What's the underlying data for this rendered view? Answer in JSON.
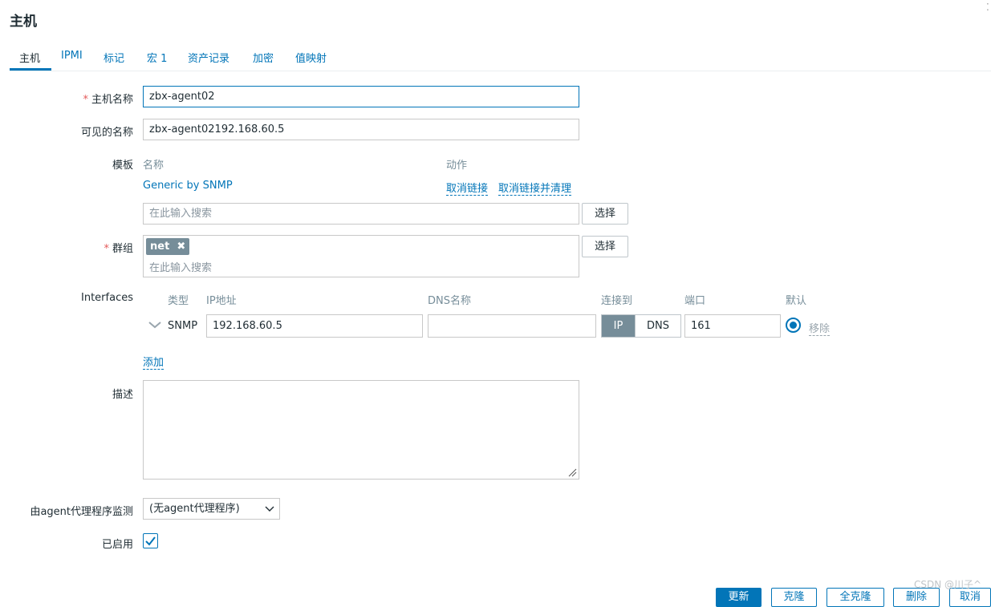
{
  "page_title": "主机",
  "tabs": [
    {
      "label": "主机"
    },
    {
      "label": "IPMI"
    },
    {
      "label": "标记"
    },
    {
      "label": "宏 1"
    },
    {
      "label": "资产记录"
    },
    {
      "label": "加密"
    },
    {
      "label": "值映射"
    }
  ],
  "form": {
    "host_name": {
      "label": "主机名称",
      "required_mark": "*",
      "value": "zbx-agent02"
    },
    "visible_name": {
      "label": "可见的名称",
      "value": "zbx-agent02192.168.60.5"
    },
    "templates": {
      "label": "模板",
      "col_name": "名称",
      "col_action": "动作",
      "items": [
        {
          "name": "Generic by SNMP",
          "unlink": "取消链接",
          "unlink_clear": "取消链接并清理"
        }
      ],
      "search_placeholder": "在此输入搜索",
      "select_button": "选择"
    },
    "groups": {
      "label": "群组",
      "required_mark": "*",
      "tags": [
        {
          "label": "net",
          "remove_icon": "✖"
        }
      ],
      "search_placeholder": "在此输入搜索",
      "select_button": "选择"
    },
    "interfaces": {
      "label": "Interfaces",
      "col_type": "类型",
      "col_ip": "IP地址",
      "col_dns": "DNS名称",
      "col_connect": "连接到",
      "col_port": "端口",
      "col_default": "默认",
      "rows": [
        {
          "type": "SNMP",
          "ip": "192.168.60.5",
          "dns": "",
          "connect_ip": "IP",
          "connect_dns": "DNS",
          "port": "161",
          "remove": "移除"
        }
      ],
      "add_link": "添加"
    },
    "description": {
      "label": "描述",
      "value": ""
    },
    "proxy": {
      "label": "由agent代理程序监测",
      "selected": "(无agent代理程序)"
    },
    "enabled": {
      "label": "已启用",
      "checked": true
    }
  },
  "footer": {
    "buttons": [
      "更新",
      "克隆",
      "全克隆",
      "删除",
      "取消"
    ]
  },
  "watermark": "CSDN @川子^",
  "colors": {
    "accent": "#0275b8",
    "required": "#e45959",
    "tag_bg": "#768d99"
  }
}
